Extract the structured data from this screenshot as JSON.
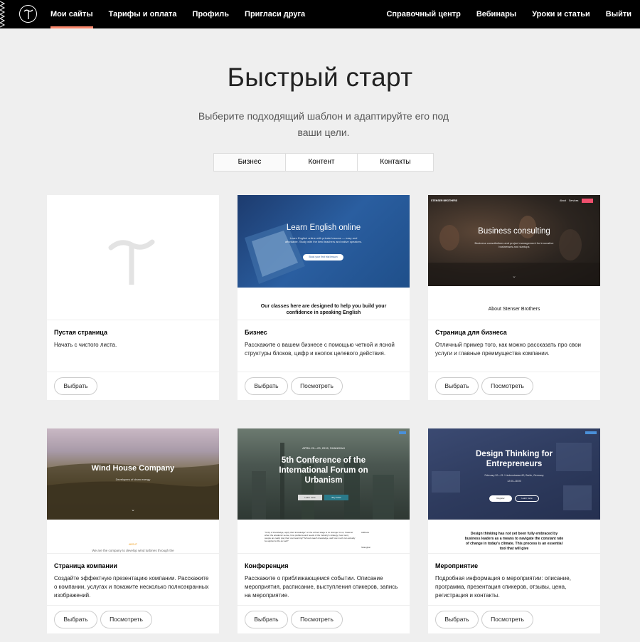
{
  "nav": {
    "left": [
      "Мои сайты",
      "Тарифы и оплата",
      "Профиль",
      "Пригласи друга"
    ],
    "right": [
      "Справочный центр",
      "Вебинары",
      "Уроки и статьи",
      "Выйти"
    ]
  },
  "hero": {
    "title": "Быстрый старт",
    "subtitle": "Выберите подходящий шаблон и адаптируйте его под ваши цели."
  },
  "tabs": [
    "Бизнес",
    "Контент",
    "Контакты"
  ],
  "cards": [
    {
      "title": "Пустая страница",
      "desc": "Начать с чистого листа.",
      "select_label": "Выбрать"
    },
    {
      "title": "Бизнес",
      "desc": "Расскажите о вашем бизнесе с помощью четкой и ясной структуры блоков, цифр и кнопок целевого действия.",
      "select_label": "Выбрать",
      "preview_label": "Посмотреть",
      "thumb_heading": "Learn English online",
      "thumb_subtext": "Learn English online with private lessons — easy and affordable. Study with the best teachers and native speakers.",
      "thumb_button": "Book your first trial lesson",
      "thumb_lower": "Our classes here are designed to help you build your confidence in speaking English"
    },
    {
      "title": "Страница для бизнеса",
      "desc": "Отличный пример того, как можно рассказать про свои услуги и главные преимущества компании.",
      "select_label": "Выбрать",
      "preview_label": "Посмотреть",
      "thumb_brand": "STENSER BROTHERS",
      "thumb_menu": [
        "About",
        "Services"
      ],
      "thumb_heading": "Business consulting",
      "thumb_subtext": "Business consultations and project management for innovative businesses and startups",
      "thumb_lower": "About Stenser Brothers"
    },
    {
      "title": "Страница компании",
      "desc": "Создайте эффектную презентацию компании. Расскажите о компании, услугах и покажите несколько полноэкранных изображений.",
      "select_label": "Выбрать",
      "preview_label": "Посмотреть",
      "thumb_heading": "Wind House Company",
      "thumb_subtext": "Developers of clean energy",
      "thumb_lower_tag": "ABOUT",
      "thumb_lower": "We are the company to develop wind turbines through the"
    },
    {
      "title": "Конференция",
      "desc": "Расскажите о приближающемся событии. Описание мероприятия, расписание, выступления спикеров, запись на мероприятие.",
      "select_label": "Выбрать",
      "preview_label": "Посмотреть",
      "thumb_date": "APRIL 20—23, 2015, SHANGHAI",
      "thumb_heading": "5th Conference of the International Forum on Urbanism",
      "thumb_btn1": "Learn more",
      "thumb_btn2": "Buy ticket",
      "thumb_lower": "\"Unity of knowledge, apply their knowledge\" on the school stage is no stranger to us, however when the academic sense, how problems and needs of the industry's strategy, how many people are really play their own learning? Schools teach knowledge, and how much can actually be applied to life as well?",
      "thumb_side": [
        "Address",
        "Shanghai"
      ]
    },
    {
      "title": "Мероприятие",
      "desc": "Подробная информация о мероприятии: описание, программа, презентация спикеров, отзывы, цена, регистрация и контакты.",
      "select_label": "Выбрать",
      "preview_label": "Посмотреть",
      "thumb_heading": "Design Thinking for Entrepreneurs",
      "thumb_subtext": "February 20—21 / Lindenstrasse 60, Berlin, Germany",
      "thumb_time": "12:00–18:00",
      "thumb_btn1": "Register",
      "thumb_btn2": "Learn more",
      "thumb_lower": "Design thinking has not yet been fully embraced by business leaders as a means to navigate the constant rate of change in today's climate. This process is an essential tool that will give"
    }
  ],
  "colors": {
    "nav_bg": "#000000",
    "nav_active_underline": "#fa876b",
    "page_bg": "#efefef"
  }
}
